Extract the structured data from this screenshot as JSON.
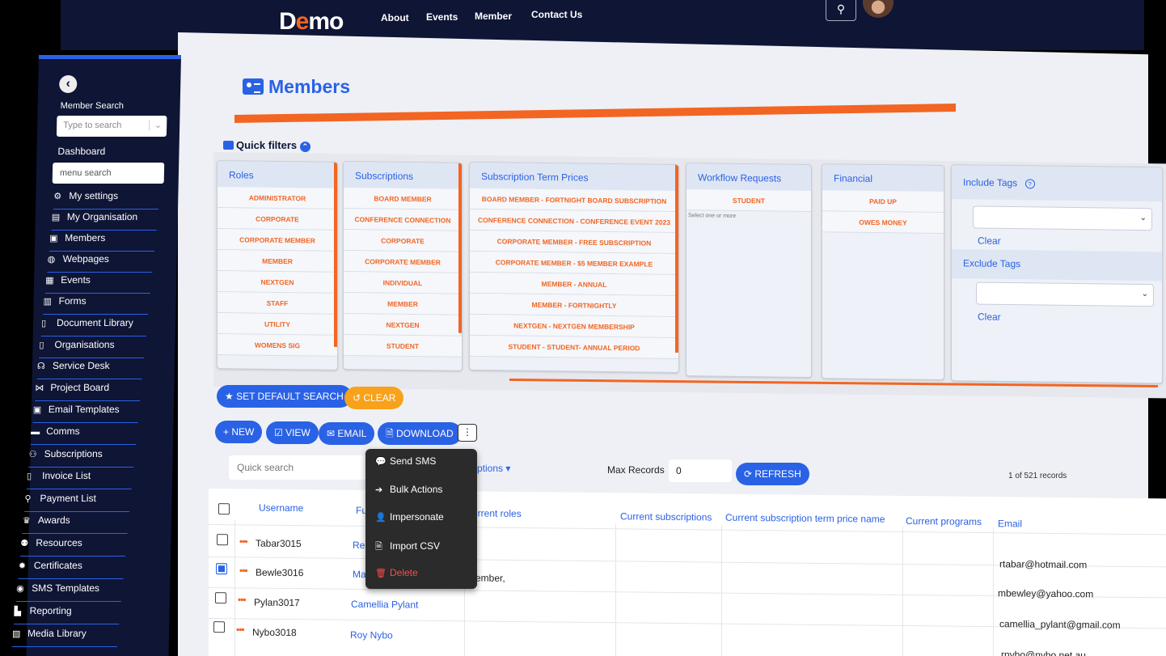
{
  "topnav": {
    "brand_prefix": "D",
    "brand_accent": "e",
    "brand_suffix": "mo",
    "links": [
      "About",
      "Events",
      "Member",
      "Contact Us"
    ]
  },
  "sidebar": {
    "member_search_label": "Member Search",
    "member_search_placeholder": "Type to search",
    "dashboard": "Dashboard",
    "menu_search_placeholder": "menu search",
    "items": [
      {
        "label": "My settings",
        "icon": "user-gear-icon"
      },
      {
        "label": "My Organisation",
        "icon": "building-icon"
      },
      {
        "label": "Members",
        "icon": "id-card-icon"
      },
      {
        "label": "Webpages",
        "icon": "globe-icon"
      },
      {
        "label": "Events",
        "icon": "calendar-icon"
      },
      {
        "label": "Forms",
        "icon": "table-icon"
      },
      {
        "label": "Document Library",
        "icon": "document-icon"
      },
      {
        "label": "Organisations",
        "icon": "sitemap-icon"
      },
      {
        "label": "Service Desk",
        "icon": "headset-icon"
      },
      {
        "label": "Project Board",
        "icon": "project-icon"
      },
      {
        "label": "Email Templates",
        "icon": "email-template-icon"
      },
      {
        "label": "Comms",
        "icon": "comments-icon"
      },
      {
        "label": "Subscriptions",
        "icon": "users-icon"
      },
      {
        "label": "Invoice List",
        "icon": "invoice-icon"
      },
      {
        "label": "Payment List",
        "icon": "search-dollar-icon"
      },
      {
        "label": "Awards",
        "icon": "trophy-icon"
      },
      {
        "label": "Resources",
        "icon": "people-carry-icon"
      },
      {
        "label": "Certificates",
        "icon": "certificate-icon"
      },
      {
        "label": "SMS Templates",
        "icon": "sms-icon"
      },
      {
        "label": "Reporting",
        "icon": "chart-icon"
      },
      {
        "label": "Media Library",
        "icon": "media-icon"
      }
    ]
  },
  "page": {
    "title": "Members",
    "quick_filters": "Quick filters"
  },
  "filters": {
    "roles": {
      "title": "Roles",
      "options": [
        "ADMINISTRATOR",
        "CORPORATE",
        "CORPORATE MEMBER",
        "MEMBER",
        "NEXTGEN",
        "STAFF",
        "UTILITY",
        "WOMENS SIG"
      ]
    },
    "subscriptions": {
      "title": "Subscriptions",
      "options": [
        "BOARD MEMBER",
        "CONFERENCE CONNECTION",
        "CORPORATE",
        "CORPORATE MEMBER",
        "INDIVIDUAL",
        "MEMBER",
        "NEXTGEN",
        "STUDENT"
      ]
    },
    "term_prices": {
      "title": "Subscription Term Prices",
      "options": [
        "BOARD MEMBER - FORTNIGHT BOARD SUBSCRIPTION",
        "CONFERENCE CONNECTION - CONFERENCE EVENT 2023",
        "CORPORATE MEMBER - FREE SUBSCRIPTION",
        "CORPORATE MEMBER - $5 MEMBER EXAMPLE",
        "MEMBER - ANNUAL",
        "MEMBER - FORTNIGHTLY",
        "NEXTGEN - NEXTGEN MEMBERSHIP",
        "STUDENT - STUDENT- ANNUAL PERIOD"
      ]
    },
    "workflow": {
      "title": "Workflow Requests",
      "options": [
        "STUDENT"
      ],
      "hint": "Select one or more"
    },
    "financial": {
      "title": "Financial",
      "options": [
        "PAID UP",
        "OWES MONEY"
      ]
    },
    "tags": {
      "include_title": "Include Tags",
      "exclude_title": "Exclude Tags",
      "clear": "Clear"
    }
  },
  "actions": {
    "set_default": "SET DEFAULT SEARCH",
    "clear": "CLEAR",
    "new": "NEW",
    "view": "VIEW",
    "email": "EMAIL",
    "download": "DOWNLOAD",
    "more": "⋮"
  },
  "menu": {
    "items": [
      "Send SMS",
      "Bulk Actions",
      "Impersonate",
      "Import CSV",
      "Delete"
    ]
  },
  "table_controls": {
    "quick_search_placeholder": "Quick search",
    "options": "ptions ▾",
    "max_records_label": "Max Records",
    "max_records_value": "0",
    "refresh": "REFRESH",
    "count": "1 of 521 records"
  },
  "table": {
    "headers": {
      "username": "Username",
      "fullname": "Fu",
      "roles": "urrent roles",
      "subs": "Current subscriptions",
      "term": "Current subscription term price name",
      "programs": "Current programs",
      "email": "Email"
    },
    "rows": [
      {
        "username": "Tabar3015",
        "name": "Re",
        "roles": "",
        "email": "rtabar@hotmail.com",
        "checked": false
      },
      {
        "username": "Bewle3016",
        "name": "Ma",
        "roles": "ember,",
        "email": "mbewley@yahoo.com",
        "checked": true
      },
      {
        "username": "Pylan3017",
        "name": "Camellia Pylant",
        "roles": "",
        "email": "camellia_pylant@gmail.com",
        "checked": false
      },
      {
        "username": "Nybo3018",
        "name": "Roy Nybo",
        "roles": "",
        "email": "rnybo@nybo.net.au",
        "checked": false
      }
    ]
  },
  "colors": {
    "navy": "#0f1535",
    "blue": "#2a62e6",
    "orange": "#f26522",
    "amber": "#f8a21b"
  }
}
